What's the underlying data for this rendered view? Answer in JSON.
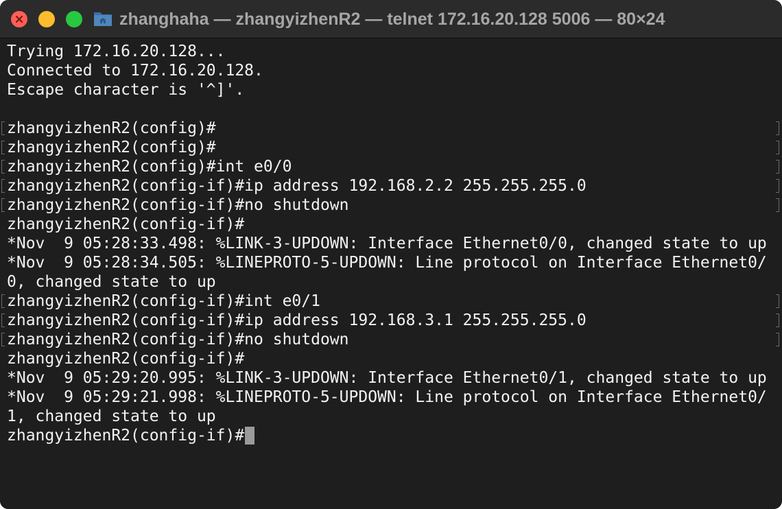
{
  "window": {
    "title": "zhanghaha — zhangyizhenR2 — telnet 172.16.20.128 5006 — 80×24",
    "title_icon": "folder-icon",
    "controls": [
      "close",
      "minimize",
      "zoom"
    ]
  },
  "terminal": {
    "lines": [
      {
        "text": "Trying 172.16.20.128...",
        "marked": false
      },
      {
        "text": "Connected to 172.16.20.128.",
        "marked": false
      },
      {
        "text": "Escape character is '^]'.",
        "marked": false
      },
      {
        "text": "",
        "marked": false
      },
      {
        "text": "zhangyizhenR2(config)#",
        "marked": true
      },
      {
        "text": "zhangyizhenR2(config)#",
        "marked": true
      },
      {
        "text": "zhangyizhenR2(config)#int e0/0",
        "marked": true
      },
      {
        "text": "zhangyizhenR2(config-if)#ip address 192.168.2.2 255.255.255.0",
        "marked": true
      },
      {
        "text": "zhangyizhenR2(config-if)#no shutdown",
        "marked": true
      },
      {
        "text": "zhangyizhenR2(config-if)#",
        "marked": false
      },
      {
        "text": "*Nov  9 05:28:33.498: %LINK-3-UPDOWN: Interface Ethernet0/0, changed state to up",
        "marked": false
      },
      {
        "text": "*Nov  9 05:28:34.505: %LINEPROTO-5-UPDOWN: Line protocol on Interface Ethernet0/",
        "marked": false
      },
      {
        "text": "0, changed state to up",
        "marked": false
      },
      {
        "text": "zhangyizhenR2(config-if)#int e0/1",
        "marked": true
      },
      {
        "text": "zhangyizhenR2(config-if)#ip address 192.168.3.1 255.255.255.0",
        "marked": true
      },
      {
        "text": "zhangyizhenR2(config-if)#no shutdown",
        "marked": true
      },
      {
        "text": "zhangyizhenR2(config-if)#",
        "marked": false
      },
      {
        "text": "*Nov  9 05:29:20.995: %LINK-3-UPDOWN: Interface Ethernet0/1, changed state to up",
        "marked": false
      },
      {
        "text": "*Nov  9 05:29:21.998: %LINEPROTO-5-UPDOWN: Line protocol on Interface Ethernet0/",
        "marked": false
      },
      {
        "text": "1, changed state to up",
        "marked": false
      },
      {
        "text": "zhangyizhenR2(config-if)#",
        "marked": false
      }
    ]
  },
  "colors": {
    "background": "#1e1e1e",
    "text": "#f2f2f2",
    "titlebar": "#2b2b2b",
    "title_text": "#a6a6a6",
    "close": "#ff5f57",
    "minimize": "#febc2e",
    "zoom": "#28c840"
  }
}
